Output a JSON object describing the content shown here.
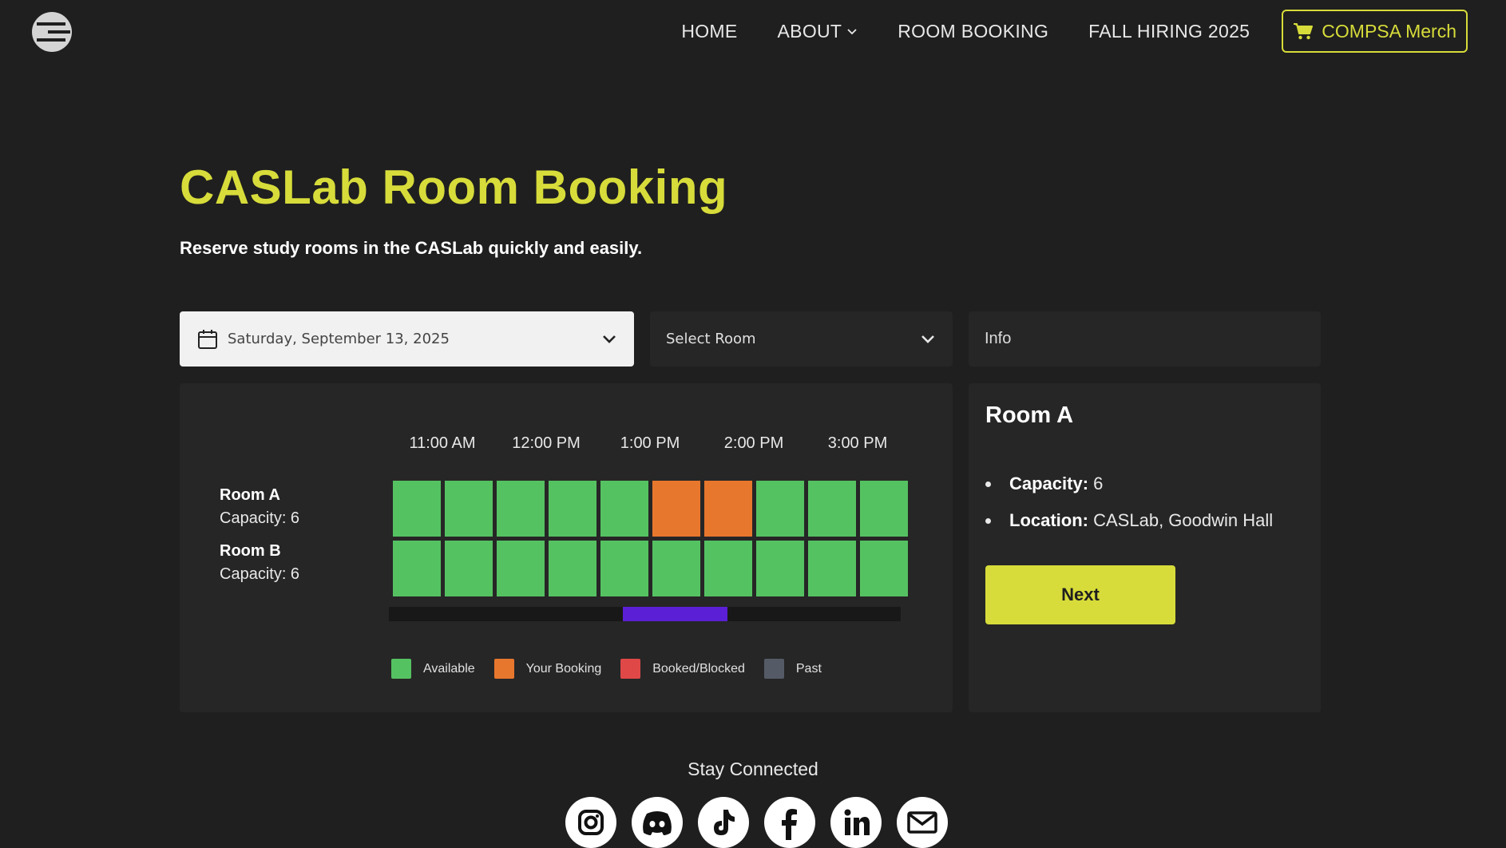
{
  "nav": {
    "logo_icon": "compsa-logo-icon",
    "links": [
      "HOME",
      "ABOUT",
      "ROOM BOOKING",
      "FALL HIRING 2025"
    ],
    "merch_label": "COMPSA Merch",
    "merch_icon": "cart-icon"
  },
  "colors": {
    "accent": "#d7dc3a",
    "background": "#1f1f1f",
    "panel": "#262626",
    "available": "#55c262",
    "your_booking": "#e8772e",
    "booked_blocked": "#e04848",
    "past": "#555b66",
    "scroll_thumb": "#5b1fd6"
  },
  "hero": {
    "title": "CASLab Room Booking",
    "subtitle": "Reserve study rooms in the CASLab quickly and easily."
  },
  "controls": {
    "date_value": "Saturday, September 13, 2025",
    "room_placeholder": "Select Room",
    "info_label": "Info"
  },
  "schedule": {
    "times": [
      "11:00 AM",
      "12:00 PM",
      "1:00 PM",
      "2:00 PM",
      "3:00 PM"
    ],
    "rooms": [
      {
        "name": "Room A",
        "capacity": "Capacity: 6",
        "slots": [
          "available",
          "available",
          "available",
          "available",
          "available",
          "yours",
          "yours",
          "available",
          "available",
          "available"
        ]
      },
      {
        "name": "Room B",
        "capacity": "Capacity: 6",
        "slots": [
          "available",
          "available",
          "available",
          "available",
          "available",
          "available",
          "available",
          "available",
          "available",
          "available"
        ]
      }
    ],
    "legend": [
      {
        "label": "Available",
        "status": "available"
      },
      {
        "label": "Your Booking",
        "status": "yours"
      },
      {
        "label": "Booked/Blocked",
        "status": "booked"
      },
      {
        "label": "Past",
        "status": "past"
      }
    ]
  },
  "info": {
    "room_title": "Room A",
    "capacity_label": "Capacity:",
    "capacity_value": "6",
    "location_label": "Location:",
    "location_value": "CASLab, Goodwin Hall",
    "next_label": "Next"
  },
  "footer": {
    "heading": "Stay Connected",
    "socials": [
      "instagram-icon",
      "discord-icon",
      "tiktok-icon",
      "facebook-icon",
      "linkedin-icon",
      "email-icon"
    ]
  }
}
